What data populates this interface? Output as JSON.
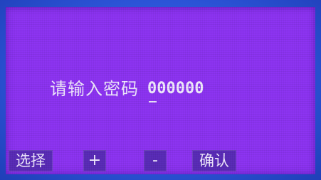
{
  "screen": {
    "prompt_label": "请输入密码",
    "password_value": "000000"
  },
  "softkeys": {
    "select_label": "选择",
    "plus_label": "+",
    "minus_label": "-",
    "confirm_label": "确认"
  },
  "colors": {
    "screen_background": "#8d34f2",
    "softkey_background": "#5a2cb8",
    "bezel": "#2c55d8",
    "text": "#f1e9ff"
  }
}
